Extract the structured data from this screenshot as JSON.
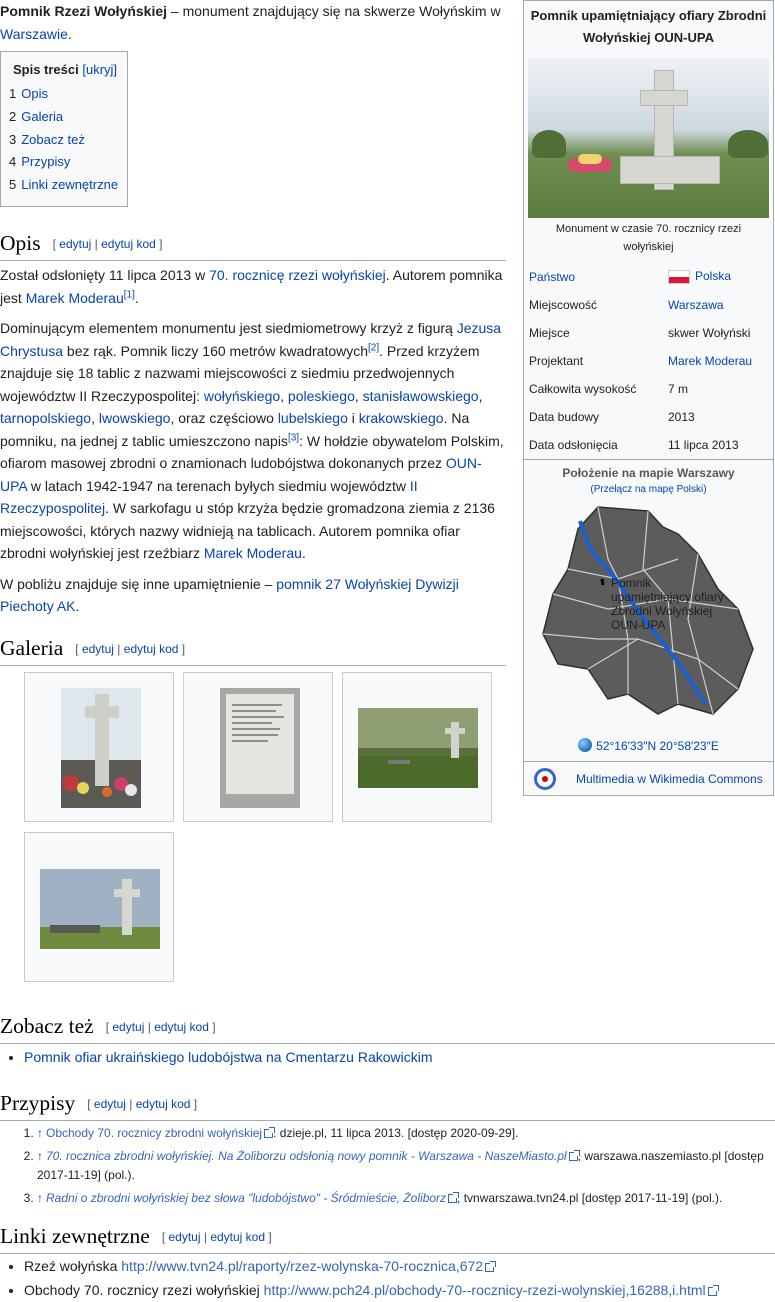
{
  "intro": {
    "title_bold": "Pomnik Rzezi Wołyńskiej",
    "text": " – monument znajdujący się na skwerze Wołyńskim w ",
    "link": "Warszawie",
    "end": "."
  },
  "toc": {
    "title": "Spis treści",
    "toggle": "[ukryj]",
    "items": [
      {
        "num": "1",
        "label": "Opis"
      },
      {
        "num": "2",
        "label": "Galeria"
      },
      {
        "num": "3",
        "label": "Zobacz też"
      },
      {
        "num": "4",
        "label": "Przypisy"
      },
      {
        "num": "5",
        "label": "Linki zewnętrzne"
      }
    ]
  },
  "edit": {
    "open": "[ ",
    "edit": "edytuj",
    "sep": " | ",
    "edit_code": "edytuj kod",
    "close": " ]"
  },
  "sections": {
    "opis": "Opis",
    "galeria": "Galeria",
    "zobacz": "Zobacz też",
    "przypisy": "Przypisy",
    "linki": "Linki zewnętrzne"
  },
  "opis": {
    "p1": {
      "t1": "Został odsłonięty 11 lipca 2013 w ",
      "l1": "70. rocznicę rzezi wołyńskiej",
      "t2": ". Autorem pomnika jest ",
      "l2": "Marek Moderau",
      "ref": "[1]",
      "t3": "."
    },
    "p2": {
      "t1": "Dominującym elementem monumentu jest siedmiometrowy krzyż z figurą ",
      "l1": "Jezusa Chrystusa",
      "t2": " bez rąk. Pomnik liczy 160 metrów kwadratowych",
      "ref2": "[2]",
      "t3": ". Przed krzyżem znajduje się 18 tablic z nazwami miejscowości z siedmiu przedwojennych województw II Rzeczypospolitej: ",
      "l2": "wołyńskiego",
      "s1": ", ",
      "l3": "poleskiego",
      "s2": ", ",
      "l4": "stanisławowskiego",
      "s3": ", ",
      "l5": "tarnopolskiego",
      "s4": ", ",
      "l6": "lwowskiego",
      "t4": ", oraz częściowo ",
      "l7": "lubelskiego",
      "t5": " i ",
      "l8": "krakowskiego",
      "t6": ". Na pomniku, na jednej z tablic umieszczono napis",
      "ref3": "[3]",
      "t7": ": W hołdzie obywatelom Polskim, ofiarom masowej zbrodni o znamionach ludobójstwa dokonanych przez ",
      "l9": "OUN-UPA",
      "t8": " w latach 1942-1947 na terenach byłych siedmiu województw ",
      "l10": "II Rzeczypospolitej",
      "t9": ". W sarkofagu u stóp krzyża będzie gromadzona ziemia z 2136 miejscowości, których nazwy widnieją na tablicach. Autorem pomnika ofiar zbrodni wołyńskiej jest rzeźbiarz ",
      "l11": "Marek Moderau",
      "t10": "."
    },
    "p3": {
      "t1": "W pobliżu znajduje się inne upamiętnienie – ",
      "l1": "pomnik 27 Wołyńskiej Dywizji Piechoty AK",
      "t2": "."
    }
  },
  "zobacz": {
    "items": [
      "Pomnik ofiar ukraińskiego ludobójstwa na Cmentarzu Rakowickim"
    ]
  },
  "przypisy": [
    {
      "caret": "↑",
      "link": "Obchody 70. rocznicy zbrodni wołyńskiej",
      "italic": false,
      "rest": ". dzieje.pl, 11 lipca 2013. [dostęp 2020-09-29]."
    },
    {
      "caret": "↑",
      "link": "70. rocznica zbrodni wołyńskiej. Na Żoliborzu odsłonią nowy pomnik - Warszawa - NaszeMiasto.pl",
      "italic": true,
      "rest": ", warszawa.naszemiasto.pl [dostęp 2017-11-19] (pol.)."
    },
    {
      "caret": "↑",
      "link": "Radni o zbrodni wołyńskiej bez słowa \"ludobójstwo\" - Śródmieście, Żoliborz",
      "italic": true,
      "rest": ", tvnwarszawa.tvn24.pl [dostęp 2017-11-19] (pol.)."
    }
  ],
  "linki": [
    {
      "text": "Rzeź wołyńska ",
      "url": "http://www.tvn24.pl/raporty/rzez-wolynska-70-rocznica,672"
    },
    {
      "text": "Obchody 70. rocznicy rzezi wołyńskiej ",
      "url": "http://www.pch24.pl/obchody-70--rocznicy-rzezi-wolynskiej,16288,i.html"
    }
  ],
  "infobox": {
    "title": "Pomnik upamiętniający ofiary Zbrodni Wołyńskiej OUN-UPA",
    "caption": "Monument w czasie 70. rocznicy rzezi wołyńskiej",
    "rows": [
      {
        "key": "Państwo",
        "key_link": true,
        "value": "Polska",
        "value_link": true,
        "flag": true
      },
      {
        "key": "Miejscowość",
        "key_link": false,
        "value": "Warszawa",
        "value_link": true
      },
      {
        "key": "Miejsce",
        "key_link": false,
        "value": "skwer Wołyński",
        "value_link": false
      },
      {
        "key": "Projektant",
        "key_link": false,
        "value": "Marek Moderau",
        "value_link": true
      },
      {
        "key": "Całkowita wysokość",
        "key_link": false,
        "value": "7 m",
        "value_link": false
      },
      {
        "key": "Data budowy",
        "key_link": false,
        "value": "2013",
        "value_link": false
      },
      {
        "key": "Data odsłonięcia",
        "key_link": false,
        "value": "11 lipca 2013",
        "value_link": false
      }
    ],
    "map_title": "Położenie na mapie Warszawy",
    "map_switch": "(Przełącz na mapę Polski)",
    "map_label": "Pomnik upamiętniający ofiary Zbrodni Wołyńskiej OUN-UPA",
    "coords": "52°16′33″N 20°58′23″E",
    "commons": "Multimedia w Wikimedia Commons"
  },
  "colors": {
    "link": "#0645ad",
    "border": "#a2a9b1",
    "infobox_bg": "#f8f9fa",
    "flag_red": "#dc143c",
    "river": "#1a5fd0"
  }
}
